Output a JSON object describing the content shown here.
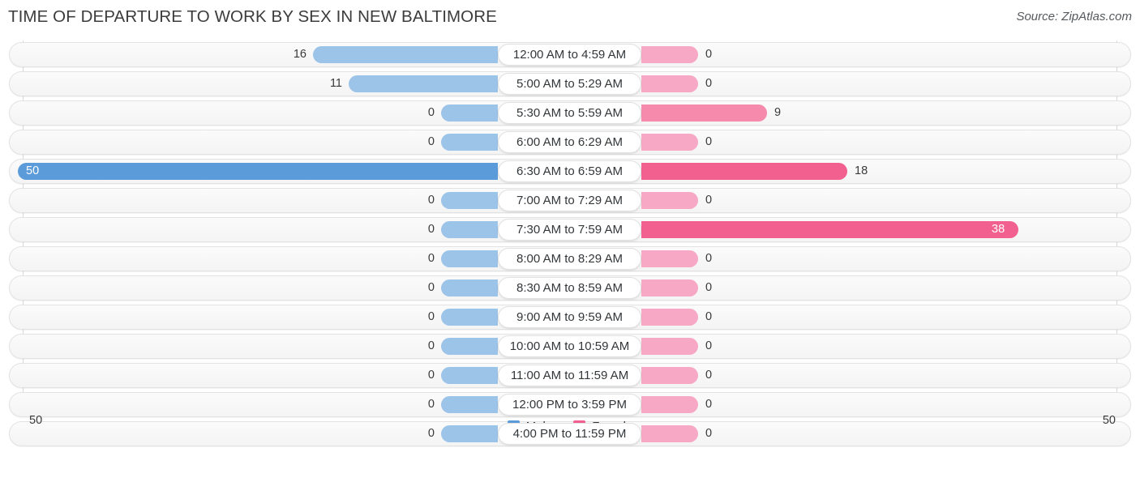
{
  "header": {
    "title": "TIME OF DEPARTURE TO WORK BY SEX IN NEW BALTIMORE",
    "source": "Source: ZipAtlas.com"
  },
  "axis": {
    "left_label": "50",
    "right_label": "50"
  },
  "legend": {
    "items": [
      {
        "label": "Male",
        "color": "#5b9bd9"
      },
      {
        "label": "Female",
        "color": "#f2608f"
      }
    ]
  },
  "colors": {
    "male_light": "#9cc3e8",
    "male_strong": "#5b9bd9",
    "female_light": "#f6a8c4",
    "female_mid": "#f58aac",
    "female_strong": "#f2608f",
    "track": "#f7f7f7",
    "gridline": "#d8d8d8"
  },
  "chart_data": {
    "type": "bar",
    "orientation": "horizontal-diverging",
    "title": "TIME OF DEPARTURE TO WORK BY SEX IN NEW BALTIMORE",
    "xlabel": "",
    "ylabel": "",
    "xlim": [
      50,
      50
    ],
    "grid": true,
    "legend_position": "bottom-center",
    "categories": [
      "12:00 AM to 4:59 AM",
      "5:00 AM to 5:29 AM",
      "5:30 AM to 5:59 AM",
      "6:00 AM to 6:29 AM",
      "6:30 AM to 6:59 AM",
      "7:00 AM to 7:29 AM",
      "7:30 AM to 7:59 AM",
      "8:00 AM to 8:29 AM",
      "8:30 AM to 8:59 AM",
      "9:00 AM to 9:59 AM",
      "10:00 AM to 10:59 AM",
      "11:00 AM to 11:59 AM",
      "12:00 PM to 3:59 PM",
      "4:00 PM to 11:59 PM"
    ],
    "series": [
      {
        "name": "Male",
        "values": [
          16,
          11,
          0,
          0,
          50,
          0,
          0,
          0,
          0,
          0,
          0,
          0,
          0,
          0
        ]
      },
      {
        "name": "Female",
        "values": [
          0,
          0,
          9,
          0,
          18,
          0,
          38,
          0,
          0,
          0,
          0,
          0,
          0,
          0
        ]
      }
    ]
  },
  "rows": [
    {
      "label": "12:00 AM to 4:59 AM",
      "male": "16",
      "female": "0",
      "male_w": 228,
      "female_w": 70,
      "male_style": "",
      "female_style": "",
      "male_inside": false,
      "female_inside": false
    },
    {
      "label": "5:00 AM to 5:29 AM",
      "male": "11",
      "female": "0",
      "male_w": 184,
      "female_w": 70,
      "male_style": "",
      "female_style": "",
      "male_inside": false,
      "female_inside": false
    },
    {
      "label": "5:30 AM to 5:59 AM",
      "male": "0",
      "female": "9",
      "male_w": 70,
      "female_w": 155,
      "male_style": "",
      "female_style": "mid",
      "male_inside": false,
      "female_inside": false
    },
    {
      "label": "6:00 AM to 6:29 AM",
      "male": "0",
      "female": "0",
      "male_w": 70,
      "female_w": 70,
      "male_style": "",
      "female_style": "",
      "male_inside": false,
      "female_inside": false
    },
    {
      "label": "6:30 AM to 6:59 AM",
      "male": "50",
      "female": "18",
      "male_w": 592,
      "female_w": 254,
      "male_style": "hi",
      "female_style": "hi",
      "male_inside": true,
      "female_inside": false
    },
    {
      "label": "7:00 AM to 7:29 AM",
      "male": "0",
      "female": "0",
      "male_w": 70,
      "female_w": 70,
      "male_style": "",
      "female_style": "",
      "male_inside": false,
      "female_inside": false
    },
    {
      "label": "7:30 AM to 7:59 AM",
      "male": "0",
      "female": "38",
      "male_w": 70,
      "female_w": 465,
      "male_style": "",
      "female_style": "hi",
      "male_inside": false,
      "female_inside": true
    },
    {
      "label": "8:00 AM to 8:29 AM",
      "male": "0",
      "female": "0",
      "male_w": 70,
      "female_w": 70,
      "male_style": "",
      "female_style": "",
      "male_inside": false,
      "female_inside": false
    },
    {
      "label": "8:30 AM to 8:59 AM",
      "male": "0",
      "female": "0",
      "male_w": 70,
      "female_w": 70,
      "male_style": "",
      "female_style": "",
      "male_inside": false,
      "female_inside": false
    },
    {
      "label": "9:00 AM to 9:59 AM",
      "male": "0",
      "female": "0",
      "male_w": 70,
      "female_w": 70,
      "male_style": "",
      "female_style": "",
      "male_inside": false,
      "female_inside": false
    },
    {
      "label": "10:00 AM to 10:59 AM",
      "male": "0",
      "female": "0",
      "male_w": 70,
      "female_w": 70,
      "male_style": "",
      "female_style": "",
      "male_inside": false,
      "female_inside": false
    },
    {
      "label": "11:00 AM to 11:59 AM",
      "male": "0",
      "female": "0",
      "male_w": 70,
      "female_w": 70,
      "male_style": "",
      "female_style": "",
      "male_inside": false,
      "female_inside": false
    },
    {
      "label": "12:00 PM to 3:59 PM",
      "male": "0",
      "female": "0",
      "male_w": 70,
      "female_w": 70,
      "male_style": "",
      "female_style": "",
      "male_inside": false,
      "female_inside": false
    },
    {
      "label": "4:00 PM to 11:59 PM",
      "male": "0",
      "female": "0",
      "male_w": 70,
      "female_w": 70,
      "male_style": "",
      "female_style": "",
      "male_inside": false,
      "female_inside": false
    }
  ]
}
